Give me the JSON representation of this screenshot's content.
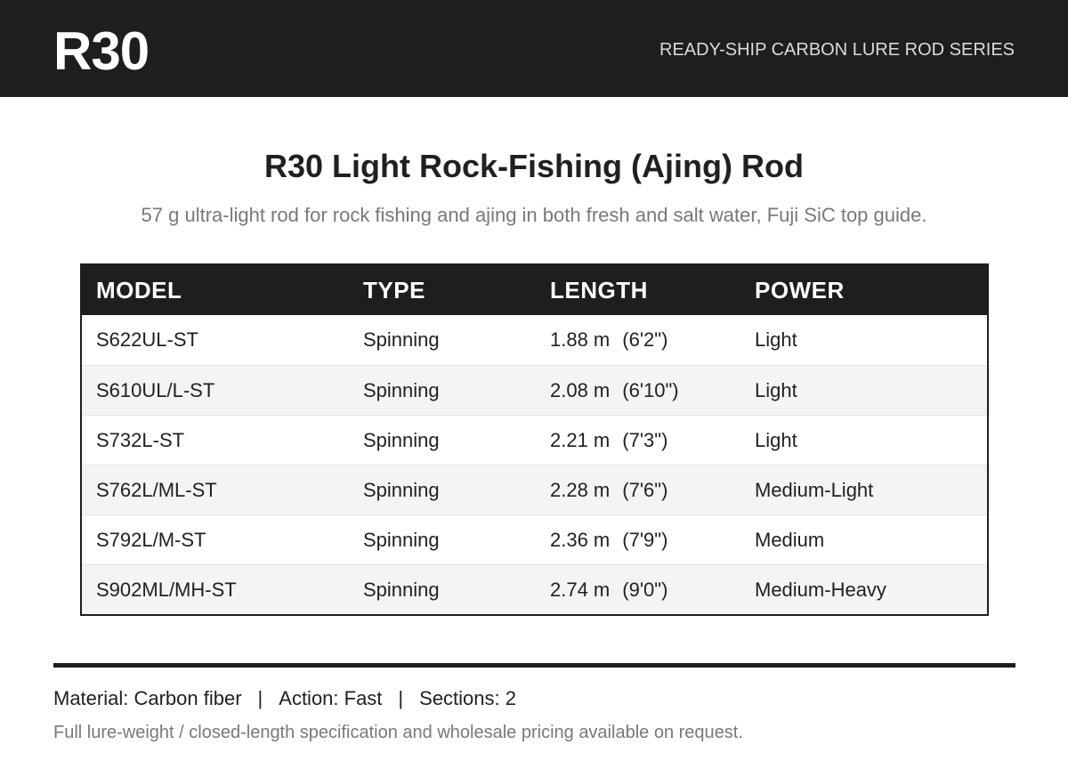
{
  "header": {
    "brand": "R30",
    "series": "READY-SHIP CARBON LURE ROD SERIES"
  },
  "product": {
    "title": "R30 Light Rock-Fishing (Ajing) Rod",
    "subtitle": "57 g ultra-light rod for rock fishing and ajing in both fresh and salt water, Fuji SiC top guide."
  },
  "table": {
    "columns": [
      "MODEL",
      "TYPE",
      "LENGTH",
      "POWER"
    ],
    "rows": [
      {
        "model": "S622UL-ST",
        "type": "Spinning",
        "length_m": "1.88 m",
        "length_ft": "(6'2\")",
        "power": "Light"
      },
      {
        "model": "S610UL/L-ST",
        "type": "Spinning",
        "length_m": "2.08 m",
        "length_ft": "(6'10\")",
        "power": "Light"
      },
      {
        "model": "S732L-ST",
        "type": "Spinning",
        "length_m": "2.21 m",
        "length_ft": "(7'3\")",
        "power": "Light"
      },
      {
        "model": "S762L/ML-ST",
        "type": "Spinning",
        "length_m": "2.28 m",
        "length_ft": "(7'6\")",
        "power": "Medium-Light"
      },
      {
        "model": "S792L/M-ST",
        "type": "Spinning",
        "length_m": "2.36 m",
        "length_ft": "(7'9\")",
        "power": "Medium"
      },
      {
        "model": "S902ML/MH-ST",
        "type": "Spinning",
        "length_m": "2.74 m",
        "length_ft": "(9'0\")",
        "power": "Medium-Heavy"
      }
    ]
  },
  "footer": {
    "specs": [
      "Material: Carbon fiber",
      "Action: Fast",
      "Sections: 2"
    ],
    "separator": "|",
    "note": "Full lure-weight / closed-length specification and wholesale pricing available on request."
  },
  "colors": {
    "dark": "#1c1e20",
    "muted_text": "#76797c",
    "row_alt": "#f3f4f6"
  }
}
